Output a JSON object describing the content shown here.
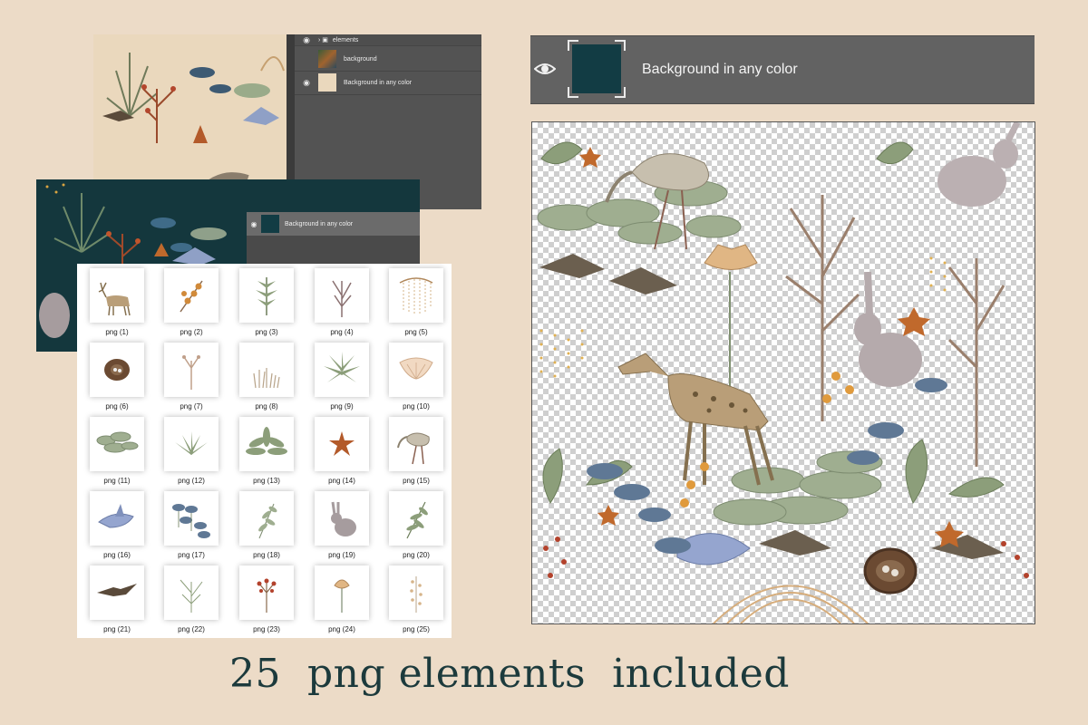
{
  "colors": {
    "page_bg": "#ecdbc7",
    "accent_teal": "#14373d",
    "panel_gray": "#535353",
    "caption_text": "#1c3a3c"
  },
  "layers_panel": {
    "rows": [
      {
        "label": "elements",
        "icon": "folder-icon",
        "visible": true
      },
      {
        "label": "background",
        "icon": "pattern-thumbnail",
        "visible": false
      },
      {
        "label": "Background in any color",
        "icon": "beige-swatch",
        "visible": true
      }
    ]
  },
  "teal_panel": {
    "row_label": "Background in any color"
  },
  "highlight_layer": {
    "label": "Background in any color",
    "swatch_color": "#123c44",
    "icon": "eye-icon"
  },
  "elements_grid": {
    "items": [
      {
        "label": "png (1)",
        "icon": "deer-icon"
      },
      {
        "label": "png (2)",
        "icon": "berry-sprig-icon"
      },
      {
        "label": "png (3)",
        "icon": "fern-leaf-icon"
      },
      {
        "label": "png (4)",
        "icon": "bare-shrub-icon"
      },
      {
        "label": "png (5)",
        "icon": "willow-icon"
      },
      {
        "label": "png (6)",
        "icon": "nest-icon"
      },
      {
        "label": "png (7)",
        "icon": "twig-icon"
      },
      {
        "label": "png (8)",
        "icon": "grass-tuft-icon"
      },
      {
        "label": "png (9)",
        "icon": "palm-cluster-icon"
      },
      {
        "label": "png (10)",
        "icon": "fan-flower-icon"
      },
      {
        "label": "png (11)",
        "icon": "lily-pads-icon"
      },
      {
        "label": "png (12)",
        "icon": "grass-clump-icon"
      },
      {
        "label": "png (13)",
        "icon": "leafy-plant-icon"
      },
      {
        "label": "png (14)",
        "icon": "star-flower-icon"
      },
      {
        "label": "png (15)",
        "icon": "heron-icon"
      },
      {
        "label": "png (16)",
        "icon": "blue-bird-icon"
      },
      {
        "label": "png (17)",
        "icon": "blue-lilies-icon"
      },
      {
        "label": "png (18)",
        "icon": "sprig-icon"
      },
      {
        "label": "png (19)",
        "icon": "rabbit-icon"
      },
      {
        "label": "png (20)",
        "icon": "fern-branch-icon"
      },
      {
        "label": "png (21)",
        "icon": "flying-bird-icon"
      },
      {
        "label": "png (22)",
        "icon": "branch-icon"
      },
      {
        "label": "png (23)",
        "icon": "red-berries-icon"
      },
      {
        "label": "png (24)",
        "icon": "thistle-icon"
      },
      {
        "label": "png (25)",
        "icon": "seed-stem-icon"
      }
    ]
  },
  "caption": "25  png elements  included"
}
